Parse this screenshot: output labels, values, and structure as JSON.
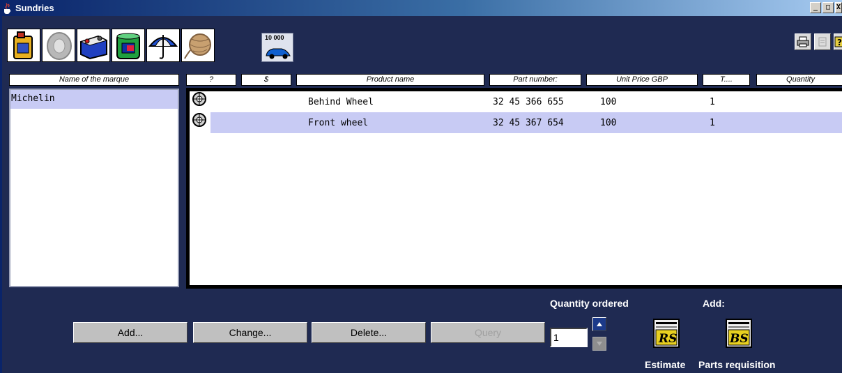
{
  "window": {
    "title": "Sundries",
    "controls": [
      "_",
      "□",
      "X"
    ]
  },
  "toolbar": {
    "tools": [
      {
        "name": "oil-can-icon"
      },
      {
        "name": "tire-icon"
      },
      {
        "name": "battery-icon"
      },
      {
        "name": "paint-can-icon"
      },
      {
        "name": "umbrella-icon"
      },
      {
        "name": "yarn-ball-icon"
      }
    ],
    "service_tool": {
      "label": "10 000",
      "icon": "car-service-icon"
    },
    "right_tools": [
      "print-icon",
      "disabled-tool-icon",
      "help-icon"
    ]
  },
  "columns": {
    "marque": "Name of the marque",
    "q": "?",
    "dollar": "$",
    "product": "Product name",
    "part": "Part number:",
    "price": "Unit Price GBP",
    "t": "T....",
    "quantity": "Quantity"
  },
  "marques": [
    "Michelin"
  ],
  "products": [
    {
      "name": "Behind Wheel",
      "part": "32 45 366 655",
      "price": "100",
      "t": "1",
      "selected": false
    },
    {
      "name": "Front wheel",
      "part": "32 45 367 654",
      "price": "100",
      "t": "1",
      "selected": true
    }
  ],
  "buttons": {
    "add": "Add...",
    "change": "Change...",
    "delete": "Delete...",
    "query": "Query"
  },
  "quantity": {
    "label": "Quantity ordered",
    "value": "1"
  },
  "add_section": {
    "label": "Add:",
    "estimate": "Estimate",
    "parts_requisition": "Parts requisition"
  },
  "colors": {
    "background": "#1f2a52",
    "selection": "#c8cbf4",
    "title_start": "#0a246a",
    "title_end": "#a6caf0"
  }
}
